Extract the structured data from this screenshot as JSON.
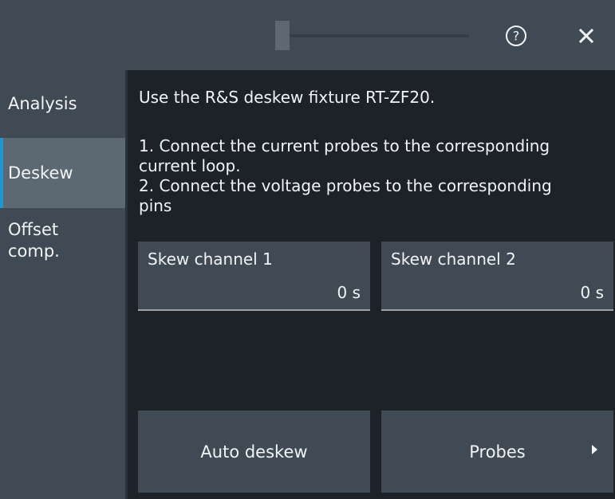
{
  "header": {
    "help_icon": "help-circle-icon",
    "close_icon": "close-icon",
    "zoom_slider": "slider"
  },
  "sidebar": {
    "items": [
      {
        "label": "Analysis"
      },
      {
        "label": "Deskew"
      },
      {
        "label": "Offset comp."
      }
    ],
    "active_color": "#1f97d6"
  },
  "main": {
    "intro": "Use the R&S deskew fixture RT-ZF20.",
    "instructions": [
      "1. Connect the current probes to the corresponding current loop.",
      "2. Connect the voltage probes to the corresponding pins"
    ],
    "fields": [
      {
        "label": "Skew channel 1",
        "value": "0 s"
      },
      {
        "label": "Skew channel 2",
        "value": "0 s"
      }
    ],
    "buttons": {
      "auto_deskew": "Auto deskew",
      "probes": "Probes"
    }
  }
}
